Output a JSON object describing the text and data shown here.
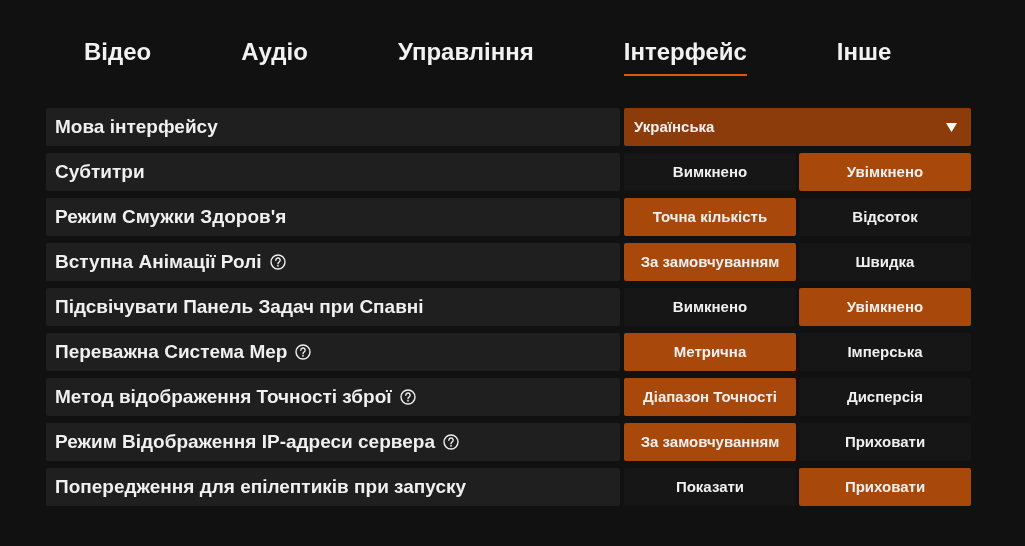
{
  "tabs": [
    {
      "label": "Відео",
      "selected": false
    },
    {
      "label": "Аудіо",
      "selected": false
    },
    {
      "label": "Управління",
      "selected": false
    },
    {
      "label": "Інтерфейс",
      "selected": true
    },
    {
      "label": "Інше",
      "selected": false
    }
  ],
  "settings": [
    {
      "label": "Мова інтерфейсу",
      "kind": "dropdown",
      "help": false,
      "value": "Українська"
    },
    {
      "label": "Субтитри",
      "kind": "toggle",
      "help": false,
      "options": [
        {
          "label": "Вимкнено",
          "selected": false
        },
        {
          "label": "Увімкнено",
          "selected": true
        }
      ]
    },
    {
      "label": "Режим Смужки Здоров'я",
      "kind": "toggle",
      "help": false,
      "options": [
        {
          "label": "Точна кількість",
          "selected": true
        },
        {
          "label": "Відсоток",
          "selected": false
        }
      ]
    },
    {
      "label": "Вступна Анімації Ролі",
      "kind": "toggle",
      "help": true,
      "options": [
        {
          "label": "За замовчуванням",
          "selected": true
        },
        {
          "label": "Швидка",
          "selected": false
        }
      ]
    },
    {
      "label": "Підсвічувати Панель Задач при Спавні",
      "kind": "toggle",
      "help": false,
      "options": [
        {
          "label": "Вимкнено",
          "selected": false
        },
        {
          "label": "Увімкнено",
          "selected": true
        }
      ]
    },
    {
      "label": "Переважна Система Мер",
      "kind": "toggle",
      "help": true,
      "options": [
        {
          "label": "Метрична",
          "selected": true
        },
        {
          "label": "Імперська",
          "selected": false
        }
      ]
    },
    {
      "label": "Метод відображення Точності зброї",
      "kind": "toggle",
      "help": true,
      "options": [
        {
          "label": "Діапазон Точності",
          "selected": true
        },
        {
          "label": "Дисперсія",
          "selected": false
        }
      ]
    },
    {
      "label": "Режим Відображення IP-адреси сервера",
      "kind": "toggle",
      "help": true,
      "options": [
        {
          "label": "За замовчуванням",
          "selected": true
        },
        {
          "label": "Приховати",
          "selected": false
        }
      ]
    },
    {
      "label": "Попередження для епілептиків при запуску",
      "kind": "toggle",
      "help": false,
      "options": [
        {
          "label": "Показати",
          "selected": false
        },
        {
          "label": "Приховати",
          "selected": true
        }
      ]
    }
  ]
}
